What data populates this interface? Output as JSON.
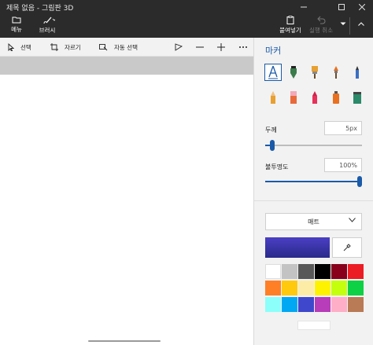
{
  "window": {
    "title": "제목 없음 - 그림판 3D"
  },
  "top_buttons": {
    "menu_label": "메뉴",
    "brush_label": "브러시",
    "paste_label": "붙여넣기",
    "undo_label": "실행 취소"
  },
  "toolbar": {
    "select_label": "선택",
    "crop_label": "자르기",
    "magic_select_label": "자동 선택"
  },
  "panel": {
    "title": "마커",
    "brushes": [
      {
        "name": "marker",
        "icon": "marker-icon",
        "selected": true
      },
      {
        "name": "calligraphy-pen",
        "icon": "calligraphy-pen-icon"
      },
      {
        "name": "oil-brush",
        "icon": "oil-brush-icon"
      },
      {
        "name": "watercolor",
        "icon": "watercolor-brush-icon"
      },
      {
        "name": "pixel-pen",
        "icon": "pixel-pen-icon"
      },
      {
        "name": "pencil",
        "icon": "pencil-icon"
      },
      {
        "name": "eraser",
        "icon": "eraser-icon"
      },
      {
        "name": "crayon",
        "icon": "crayon-icon"
      },
      {
        "name": "spray-can",
        "icon": "spray-can-icon"
      },
      {
        "name": "fill",
        "icon": "fill-bucket-icon"
      }
    ],
    "thickness_label": "두께",
    "thickness_value": "5px",
    "thickness_level": 0.05,
    "opacity_label": "불투명도",
    "opacity_value": "100%",
    "opacity_level": 1.0,
    "finish_label": "매트",
    "current_color": "#3b34b0",
    "palette": [
      "#ffffff",
      "#c3c3c3",
      "#585858",
      "#000000",
      "#88001b",
      "#ec1c24",
      "#ff7f27",
      "#ffc90e",
      "#fdeca6",
      "#fff200",
      "#c4ff0e",
      "#0ed145",
      "#8cfffb",
      "#00a8f3",
      "#3f48cc",
      "#b83dba",
      "#ffaec8",
      "#b97a56"
    ]
  }
}
